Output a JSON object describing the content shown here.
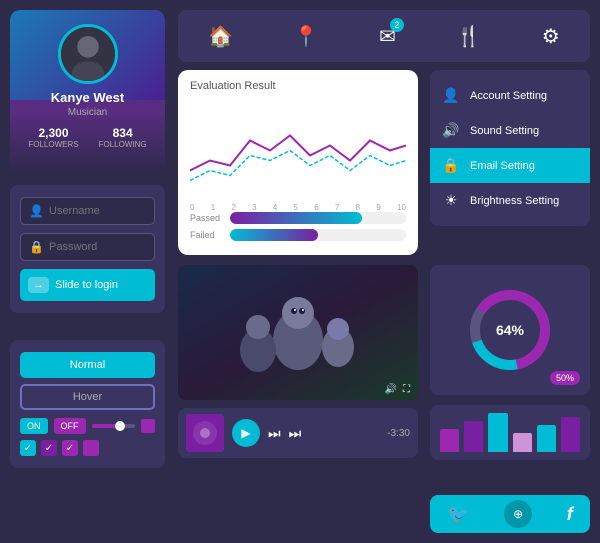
{
  "nav": {
    "icons": [
      "🏠",
      "📍",
      "✉",
      "🍴",
      "⚙"
    ],
    "badge": "2"
  },
  "profile": {
    "name": "Kanye West",
    "title": "Musician",
    "followers": "2,300",
    "followers_label": "FOLLOWERS",
    "following": "834",
    "following_label": "FOLLOWING"
  },
  "login": {
    "username_placeholder": "Username",
    "password_placeholder": "Password",
    "slide_label": "Slide to login"
  },
  "buttons": {
    "normal": "Normal",
    "hover": "Hover",
    "toggle_on": "ON",
    "toggle_off": "OFF"
  },
  "eval": {
    "title": "Evaluation Result",
    "axis_labels": [
      "0",
      "1",
      "2",
      "3",
      "4",
      "5",
      "6",
      "7",
      "8",
      "9",
      "10"
    ],
    "passed_label": "Passed",
    "failed_label": "Failed"
  },
  "settings": {
    "items": [
      {
        "icon": "👤",
        "label": "Account Setting",
        "active": false
      },
      {
        "icon": "🔊",
        "label": "Sound Setting",
        "active": false
      },
      {
        "icon": "🔒",
        "label": "Email Setting",
        "active": true
      },
      {
        "icon": "☀",
        "label": "Brightness Setting",
        "active": false
      }
    ]
  },
  "donut": {
    "percentage": "64%",
    "badge": "50%"
  },
  "music": {
    "time": "-3:30"
  },
  "bars": {
    "colors": [
      "#9c27b0",
      "#7b1fa2",
      "#00bcd4",
      "#ce93d8",
      "#00bcd4",
      "#7b1fa2"
    ],
    "heights": [
      60,
      80,
      100,
      50,
      70,
      90
    ]
  },
  "social": {
    "twitter": "🐦",
    "share": "◎",
    "facebook": "f"
  }
}
